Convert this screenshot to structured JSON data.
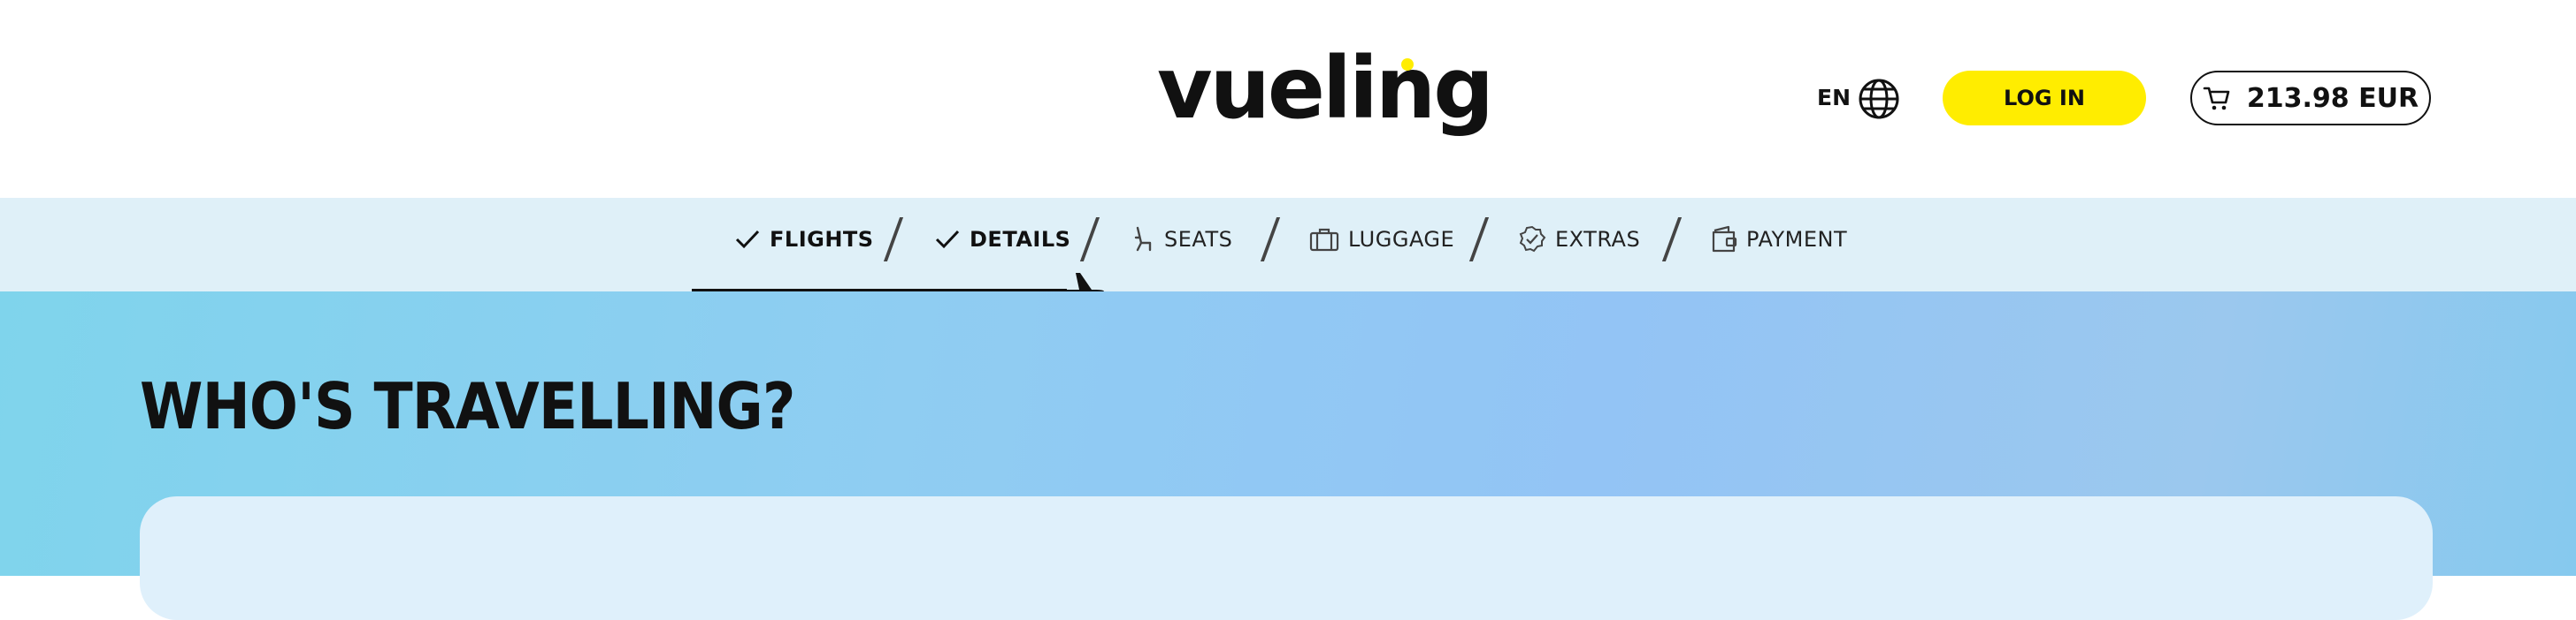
{
  "header": {
    "logo_text": "vueling",
    "language": "EN",
    "login_label": "LOG IN",
    "cart_total": "213.98 EUR"
  },
  "colors": {
    "brand_yellow": "#ffed00",
    "text_dark": "#111111",
    "stepbar_bg": "#dff0f8",
    "hero_bg": "#8fcdf2"
  },
  "steps": [
    {
      "label": "FLIGHTS",
      "icon": "check-icon",
      "state": "completed"
    },
    {
      "label": "DETAILS",
      "icon": "check-icon",
      "state": "completed"
    },
    {
      "label": "SEATS",
      "icon": "seat-icon",
      "state": "current"
    },
    {
      "label": "LUGGAGE",
      "icon": "suitcase-icon",
      "state": "upcoming"
    },
    {
      "label": "EXTRAS",
      "icon": "badge-check-icon",
      "state": "upcoming"
    },
    {
      "label": "PAYMENT",
      "icon": "wallet-icon",
      "state": "upcoming"
    }
  ],
  "progress": {
    "completed_steps": 2,
    "total_steps": 6
  },
  "main": {
    "title": "WHO'S TRAVELLING?"
  }
}
